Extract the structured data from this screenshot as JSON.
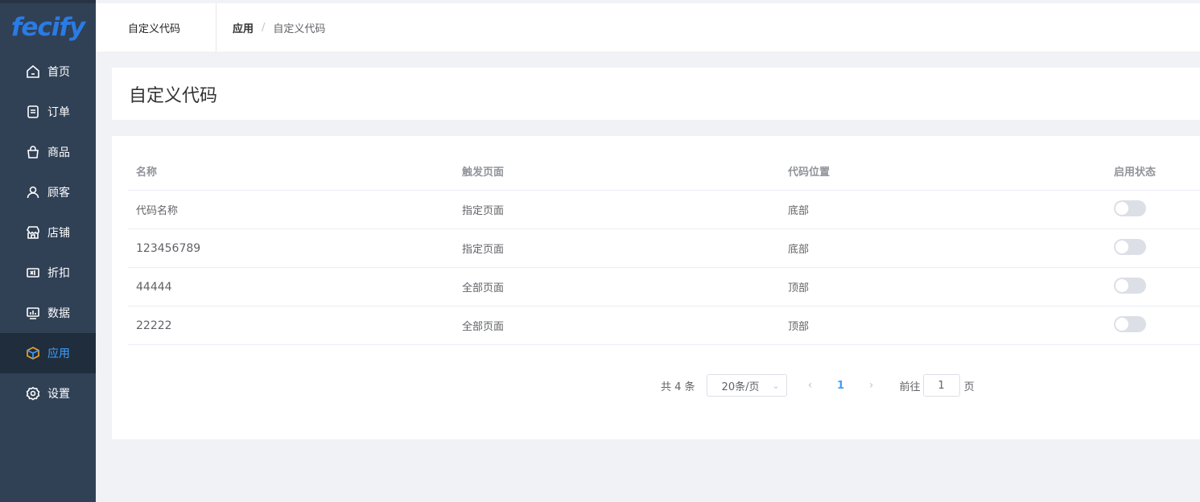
{
  "app": {
    "logo_text": "fecify"
  },
  "sidebar": {
    "items": [
      {
        "label": "首页",
        "icon": "home-icon"
      },
      {
        "label": "订单",
        "icon": "order-icon"
      },
      {
        "label": "商品",
        "icon": "bag-icon"
      },
      {
        "label": "顾客",
        "icon": "user-icon"
      },
      {
        "label": "店铺",
        "icon": "store-icon"
      },
      {
        "label": "折扣",
        "icon": "coupon-icon"
      },
      {
        "label": "数据",
        "icon": "chart-icon"
      },
      {
        "label": "应用",
        "icon": "cube-icon",
        "active": true
      },
      {
        "label": "设置",
        "icon": "gear-icon"
      }
    ]
  },
  "header": {
    "tab_title": "自定义代码",
    "breadcrumb": [
      "应用",
      "/",
      "自定义代码"
    ]
  },
  "page": {
    "title": "自定义代码"
  },
  "table": {
    "columns": [
      "名称",
      "触发页面",
      "代码位置",
      "启用状态"
    ],
    "rows": [
      {
        "name": "代码名称",
        "trigger": "指定页面",
        "position": "底部",
        "enabled": false
      },
      {
        "name": "123456789",
        "trigger": "指定页面",
        "position": "底部",
        "enabled": false
      },
      {
        "name": "44444",
        "trigger": "全部页面",
        "position": "顶部",
        "enabled": false
      },
      {
        "name": "22222",
        "trigger": "全部页面",
        "position": "顶部",
        "enabled": false
      }
    ]
  },
  "pagination": {
    "total": "共 4 条",
    "page_size": "20条/页",
    "current_page": "1",
    "goto_label": "前往",
    "goto_value": "1",
    "page_suffix": "页"
  },
  "colors": {
    "sidebar_bg": "#304156",
    "active": "#409eff"
  }
}
